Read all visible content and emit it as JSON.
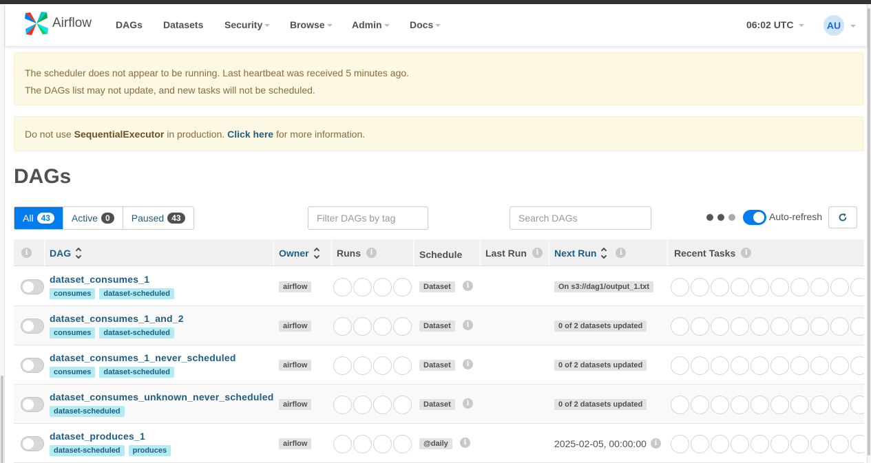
{
  "navbar": {
    "brand": "Airflow",
    "items": [
      {
        "label": "DAGs",
        "dropdown": false
      },
      {
        "label": "Datasets",
        "dropdown": false
      },
      {
        "label": "Security",
        "dropdown": true
      },
      {
        "label": "Browse",
        "dropdown": true
      },
      {
        "label": "Admin",
        "dropdown": true
      },
      {
        "label": "Docs",
        "dropdown": true
      }
    ],
    "time": "06:02 UTC",
    "user_initials": "AU"
  },
  "alerts": {
    "scheduler_line1": "The scheduler does not appear to be running. Last heartbeat was received 5 minutes ago.",
    "scheduler_line2": "The DAGs list may not update, and new tasks will not be scheduled.",
    "executor_prefix": "Do not use",
    "executor_name": "SequentialExecutor",
    "executor_mid": "in production.",
    "executor_link": "Click here",
    "executor_suffix": "for more information."
  },
  "page_title": "DAGs",
  "tabs": [
    {
      "label": "All",
      "count": "43"
    },
    {
      "label": "Active",
      "count": "0"
    },
    {
      "label": "Paused",
      "count": "43"
    }
  ],
  "filters": {
    "tag_placeholder": "Filter DAGs by tag",
    "search_placeholder": "Search DAGs",
    "autorefresh_label": "Auto-refresh"
  },
  "table": {
    "headers": {
      "dag": "DAG",
      "owner": "Owner",
      "runs": "Runs",
      "schedule": "Schedule",
      "last_run": "Last Run",
      "next_run": "Next Run",
      "recent_tasks": "Recent Tasks"
    },
    "rows": [
      {
        "name": "dataset_consumes_1",
        "tags": [
          "consumes",
          "dataset-scheduled"
        ],
        "owner": "airflow",
        "schedule": "Dataset",
        "next_run": "On s3://dag1/output_1.txt",
        "next_run_chip": true
      },
      {
        "name": "dataset_consumes_1_and_2",
        "tags": [
          "consumes",
          "dataset-scheduled"
        ],
        "owner": "airflow",
        "schedule": "Dataset",
        "next_run": "0 of 2 datasets updated",
        "next_run_chip": true
      },
      {
        "name": "dataset_consumes_1_never_scheduled",
        "tags": [
          "consumes",
          "dataset-scheduled"
        ],
        "owner": "airflow",
        "schedule": "Dataset",
        "next_run": "0 of 2 datasets updated",
        "next_run_chip": true
      },
      {
        "name": "dataset_consumes_unknown_never_scheduled",
        "tags": [
          "dataset-scheduled"
        ],
        "owner": "airflow",
        "schedule": "Dataset",
        "next_run": "0 of 2 datasets updated",
        "next_run_chip": true
      },
      {
        "name": "dataset_produces_1",
        "tags": [
          "dataset-scheduled",
          "produces"
        ],
        "owner": "airflow",
        "schedule": "@daily",
        "next_run": "2025-02-05, 00:00:00",
        "next_run_chip": false
      }
    ]
  },
  "colors": {
    "accent": "#017cee",
    "link": "#1f5d85",
    "tag_bg": "#b2ebf2",
    "alert_bg": "#fcf8e3"
  }
}
